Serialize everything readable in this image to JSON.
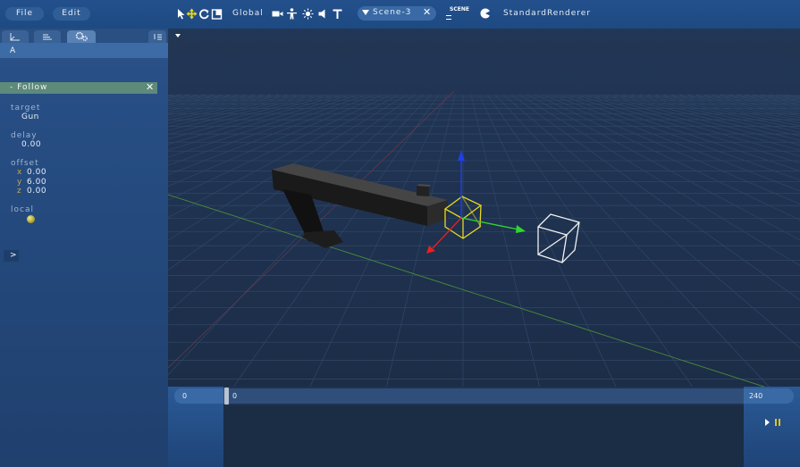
{
  "menu": {
    "file": "File",
    "edit": "Edit"
  },
  "toolbar": {
    "space": "Global",
    "scene_tab": "Scene-3",
    "scene_icon": "SCENE",
    "renderer": "StandardRenderer",
    "tools": [
      "select-icon",
      "move-icon",
      "rotate-icon",
      "scale-icon",
      "camera-icon",
      "figure-icon",
      "light-icon",
      "sound-icon",
      "text-icon"
    ]
  },
  "inspector": {
    "entity": "A",
    "component": {
      "title": "- Follow",
      "target_label": "target",
      "target_value": "Gun",
      "delay_label": "delay",
      "delay_value": "0.00",
      "offset_label": "offset",
      "offset": {
        "x_label": "x",
        "x": "0.00",
        "y_label": "y",
        "y": "6.00",
        "z_label": "z",
        "z": "0.00"
      },
      "local_label": "local",
      "local": true
    },
    "expand": ">"
  },
  "timeline": {
    "start": "0",
    "current": "0",
    "end": "240"
  },
  "colors": {
    "accent": "#3a6aa5",
    "component_header": "#5e8a7a",
    "pause": "#e0c21e",
    "selection": "#e8d91e"
  }
}
